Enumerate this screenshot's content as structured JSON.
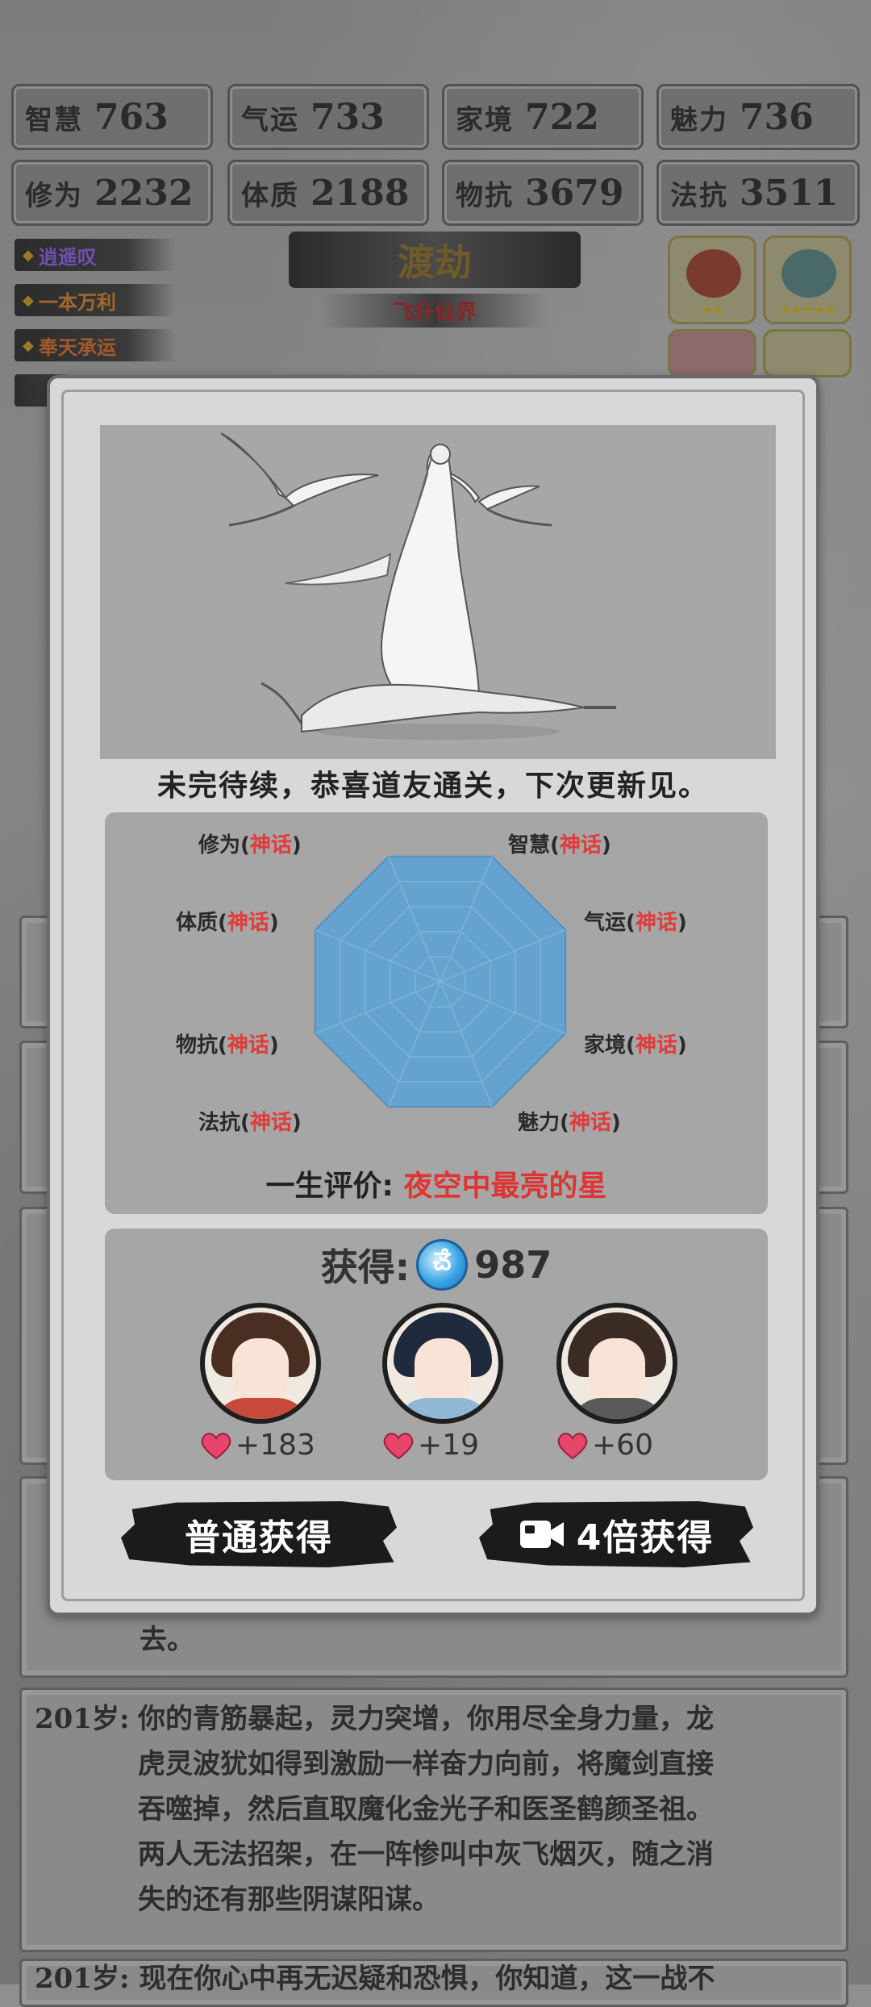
{
  "stats": [
    {
      "label": "智慧",
      "value": "763"
    },
    {
      "label": "气运",
      "value": "733"
    },
    {
      "label": "家境",
      "value": "722"
    },
    {
      "label": "魅力",
      "value": "736"
    },
    {
      "label": "修为",
      "value": "2232"
    },
    {
      "label": "体质",
      "value": "2188"
    },
    {
      "label": "物抗",
      "value": "3679"
    },
    {
      "label": "法抗",
      "value": "3511"
    }
  ],
  "talents": [
    {
      "label": "逍遥叹",
      "color": "#6f4fb0"
    },
    {
      "label": "一本万利",
      "color": "#a36a2a"
    },
    {
      "label": "奉天承运",
      "color": "#a35a2a"
    }
  ],
  "stage": {
    "title": "渡劫",
    "subtitle": "飞升仙界"
  },
  "log": {
    "fragment": "去。",
    "entry_age": "201岁:",
    "entry_lines": [
      "你的青筋暴起，灵力突增，你用尽全身力量，龙",
      "虎灵波犹如得到激励一样奋力向前，将魔剑直接",
      "吞噬掉，然后直取魔化金光子和医圣鹤颜圣祖。",
      "两人无法招架，在一阵惨叫中灰飞烟灭，随之消",
      "失的还有那些阴谋阳谋。"
    ],
    "next_line": "201岁: 现在你心中再无迟疑和恐惧，你知道，这一战不"
  },
  "modal": {
    "message": "未完待续，恭喜道友通关，下次更新见。",
    "radar": {
      "rating": "神话",
      "labels": [
        {
          "name": "修为",
          "rating": "神话"
        },
        {
          "name": "智慧",
          "rating": "神话"
        },
        {
          "name": "气运",
          "rating": "神话"
        },
        {
          "name": "家境",
          "rating": "神话"
        },
        {
          "name": "魅力",
          "rating": "神话"
        },
        {
          "name": "法抗",
          "rating": "神话"
        },
        {
          "name": "物抗",
          "rating": "神话"
        },
        {
          "name": "体质",
          "rating": "神话"
        }
      ],
      "fill_color": "#64a3cf"
    },
    "evaluation_label": "一生评价:",
    "evaluation_value": "夜空中最亮的星",
    "gain_label": "获得:",
    "gain_value": "987",
    "characters": [
      {
        "affection": "+183"
      },
      {
        "affection": "+19"
      },
      {
        "affection": "+60"
      }
    ],
    "buttons": {
      "normal": "普通获得",
      "multiplied": "4倍获得"
    }
  }
}
